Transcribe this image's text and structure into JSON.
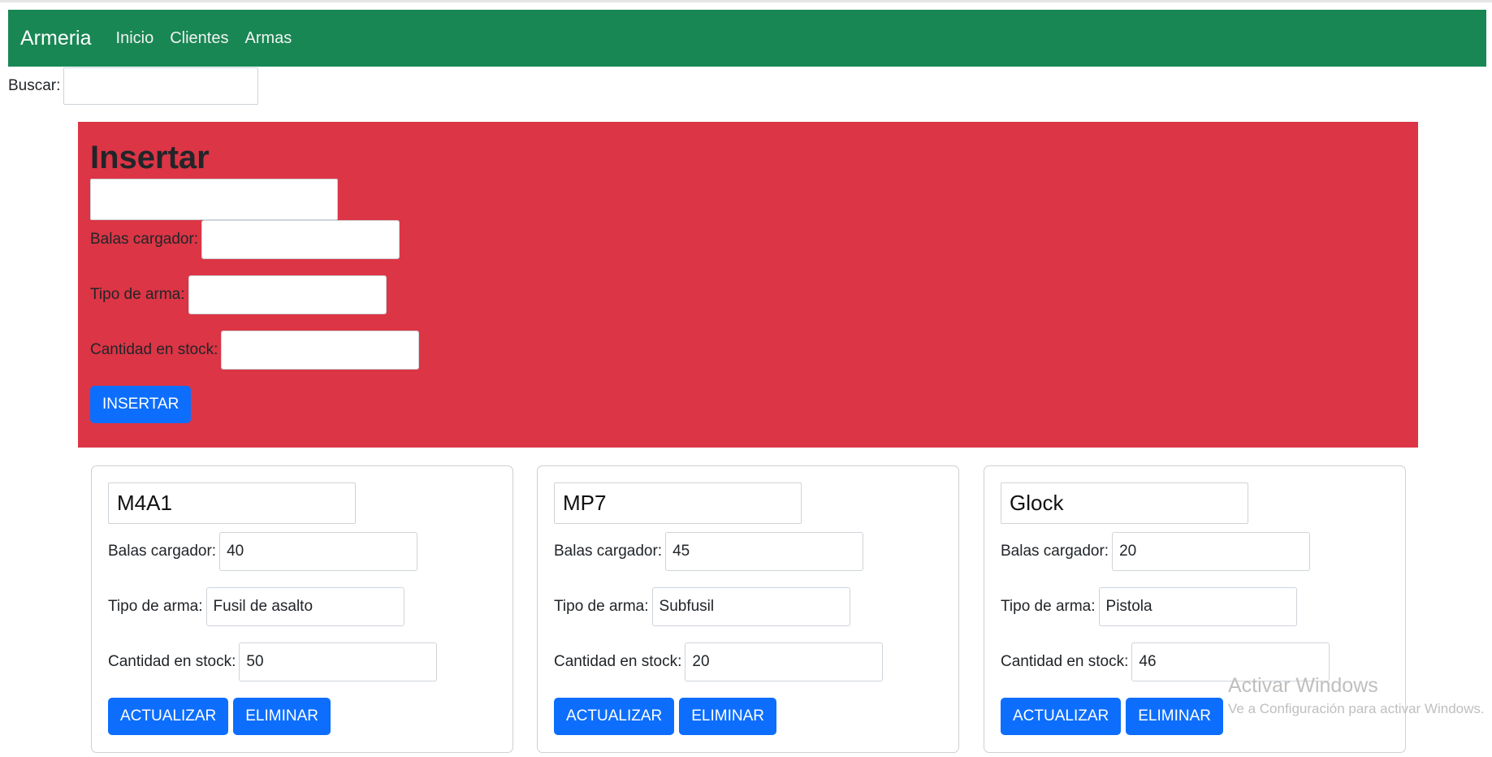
{
  "navbar": {
    "brand": "Armeria",
    "links": [
      "Inicio",
      "Clientes",
      "Armas"
    ]
  },
  "search": {
    "label": "Buscar:",
    "value": ""
  },
  "insert_form": {
    "title": "Insertar",
    "name_value": "",
    "fields": [
      {
        "label": "Balas cargador:",
        "value": ""
      },
      {
        "label": "Tipo de arma:",
        "value": ""
      },
      {
        "label": "Cantidad en stock:",
        "value": ""
      }
    ],
    "submit_label": "INSERTAR"
  },
  "weapons": [
    {
      "name": "M4A1",
      "fields": [
        {
          "label": "Balas cargador:",
          "value": "40"
        },
        {
          "label": "Tipo de arma:",
          "value": "Fusil de asalto"
        },
        {
          "label": "Cantidad en stock:",
          "value": "50"
        }
      ],
      "update_label": "ACTUALIZAR",
      "delete_label": "ELIMINAR"
    },
    {
      "name": "MP7",
      "fields": [
        {
          "label": "Balas cargador:",
          "value": "45"
        },
        {
          "label": "Tipo de arma:",
          "value": "Subfusil"
        },
        {
          "label": "Cantidad en stock:",
          "value": "20"
        }
      ],
      "update_label": "ACTUALIZAR",
      "delete_label": "ELIMINAR"
    },
    {
      "name": "Glock",
      "fields": [
        {
          "label": "Balas cargador:",
          "value": "20"
        },
        {
          "label": "Tipo de arma:",
          "value": "Pistola"
        },
        {
          "label": "Cantidad en stock:",
          "value": "46"
        }
      ],
      "update_label": "ACTUALIZAR",
      "delete_label": "ELIMINAR"
    }
  ],
  "watermark": {
    "title": "Activar Windows",
    "subtitle": "Ve a Configuración para activar Windows."
  },
  "colors": {
    "navbar": "#198754",
    "insert_panel": "#dc3545",
    "primary_button": "#0d6efd"
  }
}
